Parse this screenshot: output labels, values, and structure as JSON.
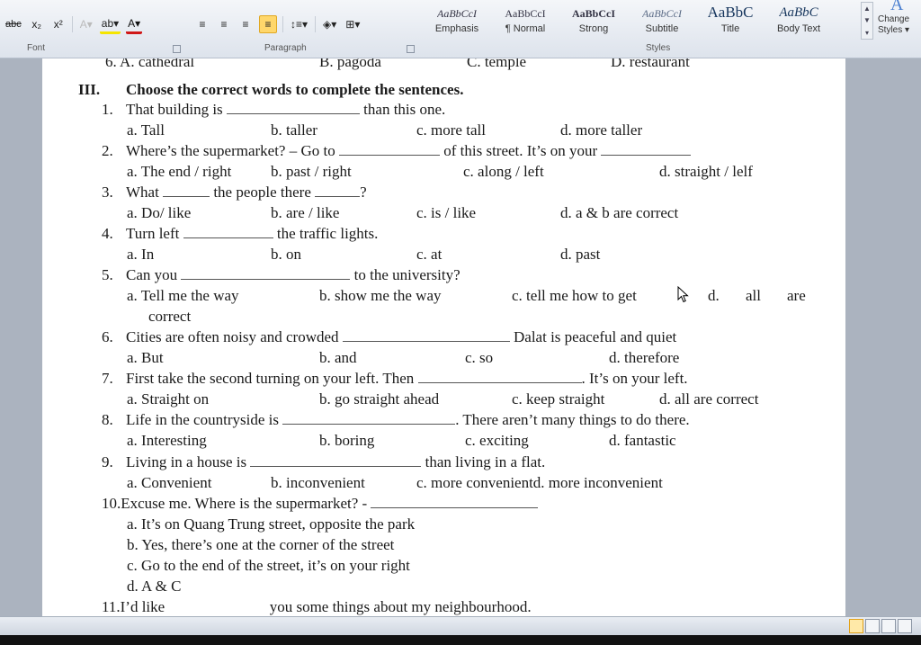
{
  "ribbon": {
    "font_group_label": "Font",
    "paragraph_group_label": "Paragraph",
    "styles_group_label": "Styles",
    "font_buttons": [
      "abc",
      "x₂",
      "x²"
    ],
    "styles": [
      {
        "sample": "AaBbCcI",
        "name": "Emphasis"
      },
      {
        "sample": "AaBbCcI",
        "name": "¶ Normal"
      },
      {
        "sample": "AaBbCcI",
        "name": "Strong"
      },
      {
        "sample": "AaBbCcI",
        "name": "Subtitle"
      },
      {
        "sample": "AaBbC",
        "name": "Title"
      },
      {
        "sample": "AaBbC",
        "name": "Body Text"
      }
    ],
    "change_styles": "Change Styles ▾"
  },
  "document": {
    "cut_line": {
      "a": "6. A. cathedral",
      "b": "B. pagoda",
      "c": "C. temple",
      "d": "D. restaurant"
    },
    "section_num": "III.",
    "section_title": "Choose the correct words to complete the sentences.",
    "questions": [
      {
        "num": "1.",
        "parts": [
          "That building is",
          "than this one."
        ],
        "options": [
          "a. Tall",
          "b. taller",
          "c. more tall",
          "d. more taller"
        ]
      },
      {
        "num": "2.",
        "parts": [
          "Where’s the supermarket? – Go to",
          "of this street. It’s on your"
        ],
        "options": [
          "a. The end / right",
          "b. past / right",
          "c. along / left",
          "d. straight / lelf"
        ]
      },
      {
        "num": "3.",
        "parts": [
          "What",
          "the people there",
          "?"
        ],
        "options": [
          "a. Do/ like",
          "b. are / like",
          "c. is / like",
          "d. a & b are correct"
        ]
      },
      {
        "num": "4.",
        "parts": [
          "Turn left",
          "the traffic lights."
        ],
        "options": [
          "a. In",
          "b. on",
          "c. at",
          "d. past"
        ]
      },
      {
        "num": "5.",
        "parts": [
          "Can you",
          "to the university?"
        ],
        "options": [
          "a. Tell me the way",
          "b. show me the way",
          "c. tell me how to get",
          "d.",
          "all",
          "are"
        ],
        "option_wrap": "correct"
      },
      {
        "num": "6.",
        "parts": [
          "Cities are often noisy and crowded",
          "Dalat is peaceful and quiet"
        ],
        "options": [
          "a. But",
          "b. and",
          "c. so",
          "d. therefore"
        ]
      },
      {
        "num": "7.",
        "parts": [
          "First take the second turning on your left. Then",
          ". It’s on your left."
        ],
        "options": [
          "a. Straight on",
          "b. go straight ahead",
          "c. keep straight",
          "d. all are correct"
        ]
      },
      {
        "num": "8.",
        "parts": [
          "Life in the countryside is",
          ". There aren’t many things to do there."
        ],
        "options": [
          "a. Interesting",
          "b. boring",
          "c. exciting",
          "d. fantastic"
        ]
      },
      {
        "num": "9.",
        "parts": [
          "Living in a house is",
          "than living in a flat."
        ],
        "options": [
          "a. Convenient",
          "b. inconvenient",
          "c. more convenientd. more inconvenient"
        ]
      },
      {
        "num": "10.",
        "parts": [
          "Excuse me. Where is the supermarket? -"
        ],
        "options": [
          "a. It’s on Quang Trung street, opposite the park",
          "b. Yes, there’s one at the corner of the street",
          "c. Go to the end of the street, it’s on your right",
          "d. A & C"
        ]
      },
      {
        "num": "11.",
        "parts": [
          "I’d like",
          "you some things about my neighbourhood."
        ]
      }
    ]
  }
}
